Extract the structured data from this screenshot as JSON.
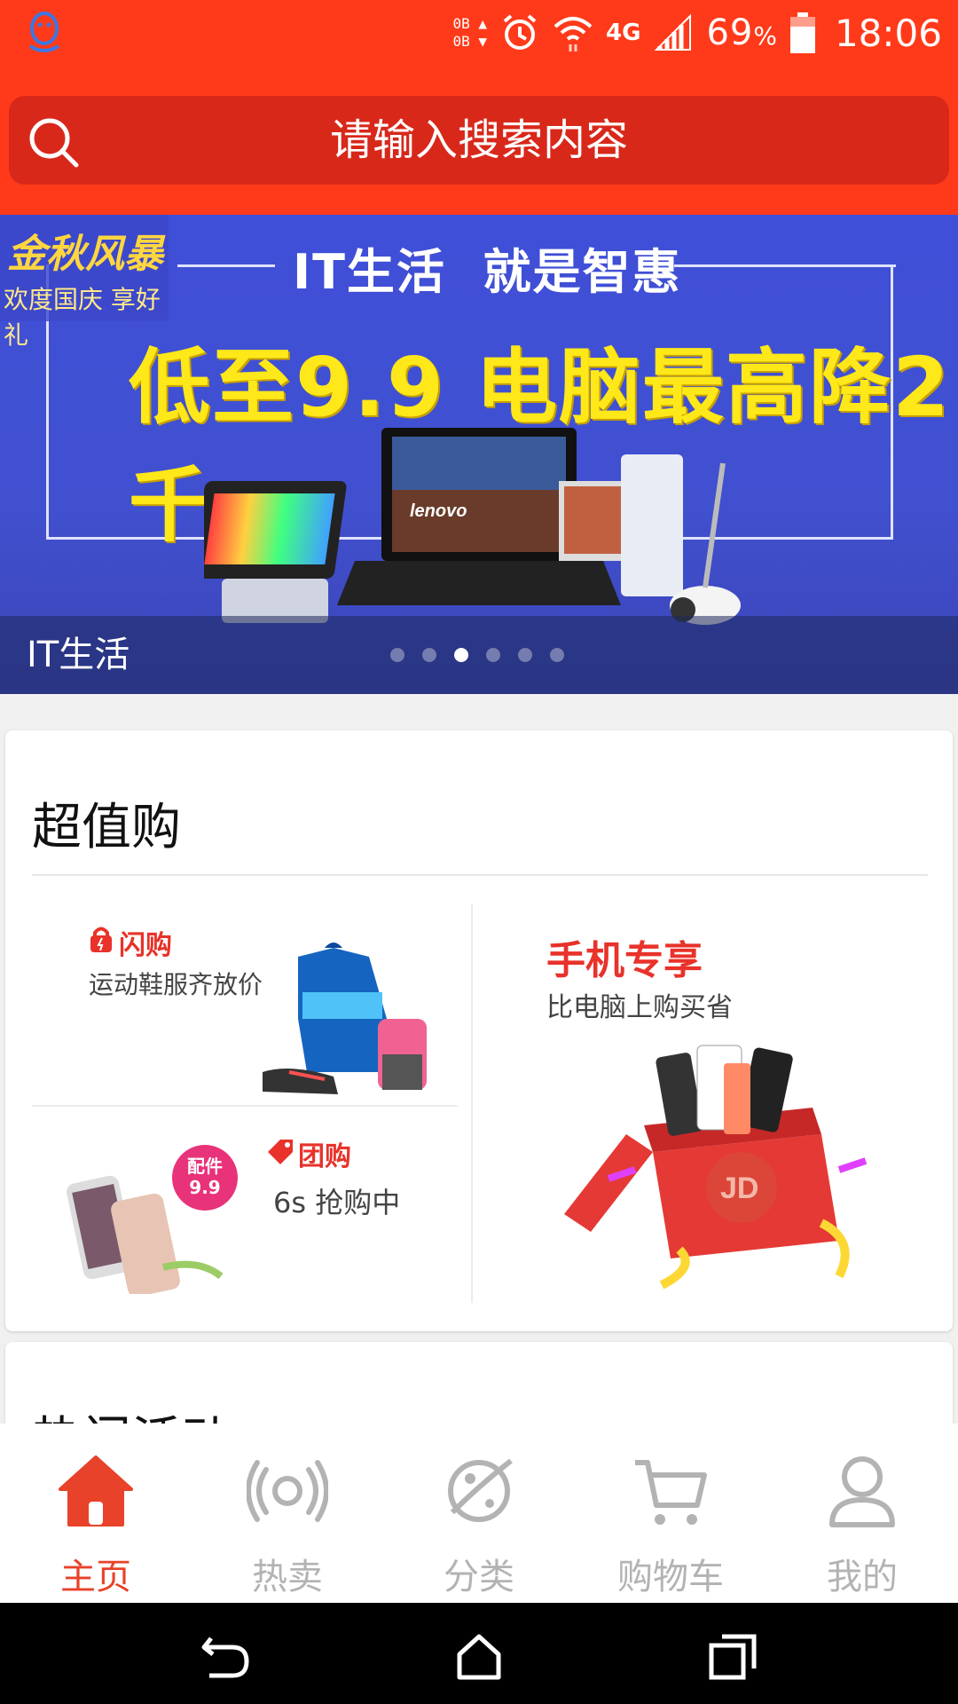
{
  "status_bar": {
    "data_up": "0B",
    "data_down": "0B",
    "network": "4G",
    "battery_percent": "69",
    "battery_unit": "%",
    "time": "18:06",
    "icons": [
      "qq-icon",
      "alarm-icon",
      "wifi-icon",
      "signal-icon",
      "battery-icon"
    ]
  },
  "search": {
    "placeholder": "请输入搜索内容"
  },
  "banner": {
    "tag_title": "金秋风暴",
    "tag_subtitle": "欢度国庆 享好礼",
    "subheadline": "IT生活  就是智惠",
    "headline": "低至9.9 电脑最高降2千",
    "laptop_brand": "lenovo",
    "caption": "IT生活",
    "slide_count": 6,
    "active_slide": 3
  },
  "deals_section": {
    "title": "超值购",
    "flash_sale": {
      "label": "闪购",
      "description": "运动鞋服齐放价"
    },
    "group_buy": {
      "label": "团购",
      "description": "6s 抢购中",
      "badge_line1": "配件",
      "badge_line2": "9.9"
    },
    "mobile_exclusive": {
      "label": "手机专享",
      "description": "比电脑上购买省",
      "box_logo": "JD"
    }
  },
  "events_section": {
    "title": "热门活动"
  },
  "bottom_nav": {
    "items": [
      {
        "label": "主页",
        "icon": "home-icon",
        "active": true
      },
      {
        "label": "热卖",
        "icon": "hot-signal-icon",
        "active": false
      },
      {
        "label": "分类",
        "icon": "category-planet-icon",
        "active": false
      },
      {
        "label": "购物车",
        "icon": "cart-icon",
        "active": false
      },
      {
        "label": "我的",
        "icon": "profile-icon",
        "active": false
      }
    ]
  },
  "colors": {
    "brand_red": "#ff3a1a",
    "search_bg": "#d8281a",
    "active_nav": "#e8422a",
    "inactive_nav": "#b3b3b3"
  }
}
